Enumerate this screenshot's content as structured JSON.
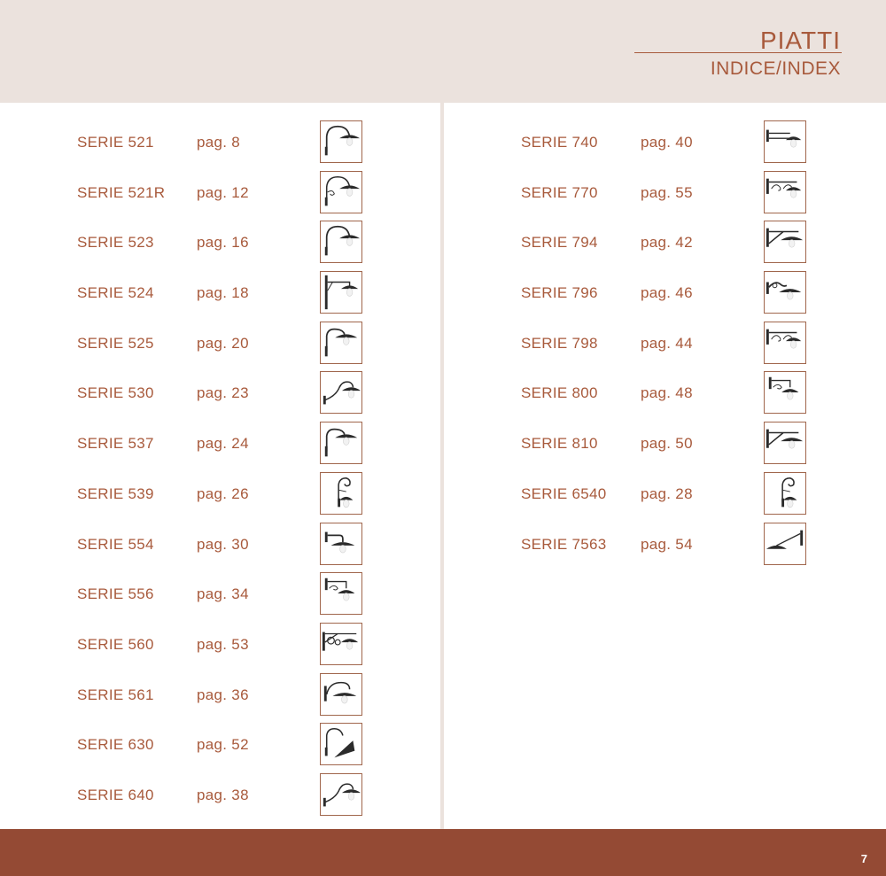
{
  "header": {
    "title": "PIATTI",
    "subtitle": "INDICE/INDEX"
  },
  "left": [
    {
      "serie": "SERIE 521",
      "pag": "pag. 8",
      "icon": "lamp-521-icon",
      "style": "gooseneck"
    },
    {
      "serie": "SERIE 521R",
      "pag": "pag. 12",
      "icon": "lamp-521r-icon",
      "style": "gooseneck-scroll"
    },
    {
      "serie": "SERIE 523",
      "pag": "pag. 16",
      "icon": "lamp-523-icon",
      "style": "gooseneck"
    },
    {
      "serie": "SERIE 524",
      "pag": "pag. 18",
      "icon": "lamp-524-icon",
      "style": "square-bracket"
    },
    {
      "serie": "SERIE 525",
      "pag": "pag. 20",
      "icon": "lamp-525-icon",
      "style": "gooseneck-short"
    },
    {
      "serie": "SERIE 530",
      "pag": "pag. 23",
      "icon": "lamp-530-icon",
      "style": "swan"
    },
    {
      "serie": "SERIE 537",
      "pag": "pag. 24",
      "icon": "lamp-537-icon",
      "style": "gooseneck-short"
    },
    {
      "serie": "SERIE 539",
      "pag": "pag. 26",
      "icon": "lamp-539-icon",
      "style": "curl"
    },
    {
      "serie": "SERIE 554",
      "pag": "pag. 30",
      "icon": "lamp-554-icon",
      "style": "angle"
    },
    {
      "serie": "SERIE 556",
      "pag": "pag. 34",
      "icon": "lamp-556-icon",
      "style": "scroll-bracket"
    },
    {
      "serie": "SERIE 560",
      "pag": "pag. 53",
      "icon": "lamp-560-icon",
      "style": "ornate"
    },
    {
      "serie": "SERIE 561",
      "pag": "pag. 36",
      "icon": "lamp-561-icon",
      "style": "arc"
    },
    {
      "serie": "SERIE 630",
      "pag": "pag. 52",
      "icon": "lamp-630-icon",
      "style": "tilted"
    },
    {
      "serie": "SERIE 640",
      "pag": "pag. 38",
      "icon": "lamp-640-icon",
      "style": "swan"
    }
  ],
  "right": [
    {
      "serie": "SERIE 740",
      "pag": "pag. 40",
      "icon": "lamp-740-icon",
      "style": "straight-bar"
    },
    {
      "serie": "SERIE 770",
      "pag": "pag. 55",
      "icon": "lamp-770-icon",
      "style": "scroll-bar"
    },
    {
      "serie": "SERIE 794",
      "pag": "pag. 42",
      "icon": "lamp-794-icon",
      "style": "brace-bar"
    },
    {
      "serie": "SERIE 796",
      "pag": "pag. 46",
      "icon": "lamp-796-icon",
      "style": "short-curve"
    },
    {
      "serie": "SERIE 798",
      "pag": "pag. 44",
      "icon": "lamp-798-icon",
      "style": "scroll-bar"
    },
    {
      "serie": "SERIE 800",
      "pag": "pag. 48",
      "icon": "lamp-800-icon",
      "style": "scroll-bracket"
    },
    {
      "serie": "SERIE 810",
      "pag": "pag. 50",
      "icon": "lamp-810-icon",
      "style": "brace-bar"
    },
    {
      "serie": "SERIE 6540",
      "pag": "pag. 28",
      "icon": "lamp-6540-icon",
      "style": "curl"
    },
    {
      "serie": "SERIE 7563",
      "pag": "pag. 54",
      "icon": "lamp-7563-icon",
      "style": "diagonal"
    }
  ],
  "footer": {
    "page_number": "7"
  },
  "colors": {
    "accent": "#a85a3c",
    "header_bg": "#ebe2dd",
    "footer_bg": "#944a34"
  }
}
